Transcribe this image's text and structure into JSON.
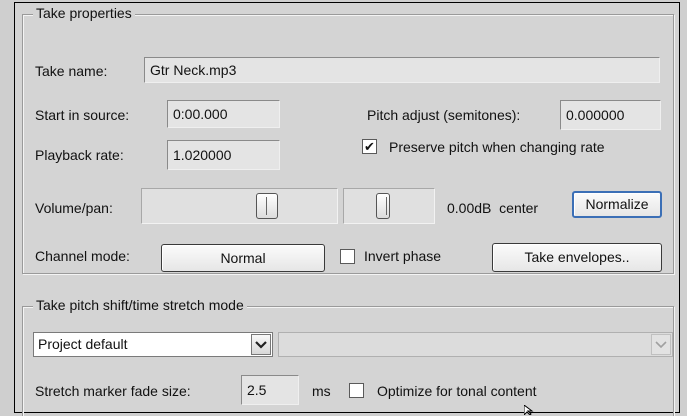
{
  "take_properties": {
    "legend": "Take properties",
    "take_name_label": "Take name:",
    "take_name_value": "Gtr Neck.mp3",
    "start_in_source_label": "Start in source:",
    "start_in_source_value": "0:00.000",
    "pitch_adjust_label": "Pitch adjust (semitones):",
    "pitch_adjust_value": "0.000000",
    "playback_rate_label": "Playback rate:",
    "playback_rate_value": "1.020000",
    "preserve_pitch_label": "Preserve pitch when changing rate",
    "preserve_pitch_checked": true,
    "preserve_pitch_mark": "✔",
    "volume_pan_label": "Volume/pan:",
    "volume_level": 0.5,
    "pan_level": 0.5,
    "volume_pan_readout": "0.00dB  center",
    "normalize_label": "Normalize",
    "channel_mode_label": "Channel mode:",
    "channel_mode_value": "Normal",
    "invert_phase_label": "Invert phase",
    "invert_phase_checked": false,
    "take_envelopes_label": "Take envelopes.."
  },
  "pitch_shift": {
    "legend": "Take pitch shift/time stretch mode",
    "mode_value": "Project default",
    "submode_value": "",
    "fade_size_label": "Stretch marker fade size:",
    "fade_size_value": "2.5",
    "fade_size_unit": "ms",
    "optimize_label": "Optimize for tonal content",
    "optimize_checked": false
  },
  "icons": [
    "chevron-down-icon",
    "checkmark-icon",
    "mouse-cursor-icon"
  ]
}
